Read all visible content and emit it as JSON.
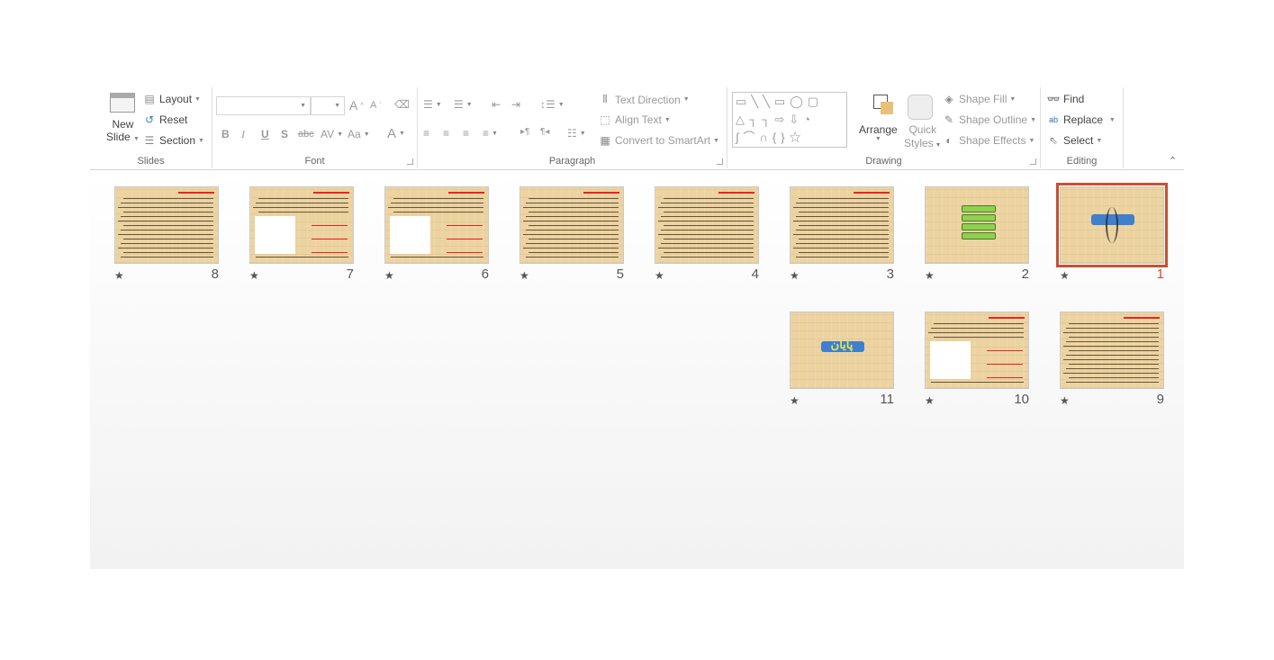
{
  "ribbon": {
    "slides": {
      "label": "Slides",
      "new_slide": "New",
      "new_slide2": "Slide",
      "layout": "Layout",
      "reset": "Reset",
      "section": "Section"
    },
    "font": {
      "label": "Font",
      "bold": "B",
      "italic": "I",
      "underline": "U",
      "shadow": "S",
      "strike": "abc",
      "spacing": "AV",
      "case": "Aa",
      "color": "A"
    },
    "paragraph": {
      "label": "Paragraph",
      "text_direction": "Text Direction",
      "align_text": "Align Text",
      "convert_smartart": "Convert to SmartArt"
    },
    "drawing": {
      "label": "Drawing",
      "arrange": "Arrange",
      "quick": "Quick",
      "styles": "Styles",
      "shape_fill": "Shape Fill",
      "shape_outline": "Shape Outline",
      "shape_effects": "Shape Effects"
    },
    "editing": {
      "label": "Editing",
      "find": "Find",
      "replace": "Replace",
      "select": "Select"
    }
  },
  "slides": [
    {
      "number": "1",
      "type": "title",
      "selected": true
    },
    {
      "number": "2",
      "type": "menu"
    },
    {
      "number": "3",
      "type": "text"
    },
    {
      "number": "4",
      "type": "text"
    },
    {
      "number": "5",
      "type": "text"
    },
    {
      "number": "6",
      "type": "image"
    },
    {
      "number": "7",
      "type": "image"
    },
    {
      "number": "8",
      "type": "text"
    },
    {
      "number": "9",
      "type": "text"
    },
    {
      "number": "10",
      "type": "image"
    },
    {
      "number": "11",
      "type": "end",
      "title": "پایان"
    }
  ],
  "colors": {
    "selection": "#c9502f",
    "parchment": "#ecd3a0"
  },
  "star_icon": "★"
}
